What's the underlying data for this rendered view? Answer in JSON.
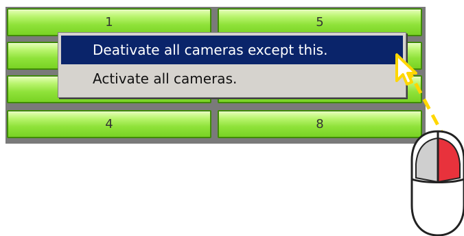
{
  "camera_grid": {
    "buttons": [
      {
        "label": "1"
      },
      {
        "label": ""
      },
      {
        "label": ""
      },
      {
        "label": "4"
      },
      {
        "label": "5"
      },
      {
        "label": ""
      },
      {
        "label": ""
      },
      {
        "label": "8"
      }
    ]
  },
  "context_menu": {
    "items": [
      {
        "label": "Deativate all cameras except this.",
        "selected": true
      },
      {
        "label": "Activate all cameras.",
        "selected": false
      }
    ]
  },
  "colors": {
    "button_green": "#8fe23a",
    "menu_highlight": "#0a246a",
    "menu_background": "#d6d3ce",
    "arrow_yellow": "#ffd700",
    "mouse_button_red": "#e8323c"
  },
  "icons": {
    "cursor": "mouse-pointer-icon",
    "mouse": "computer-mouse-icon"
  }
}
